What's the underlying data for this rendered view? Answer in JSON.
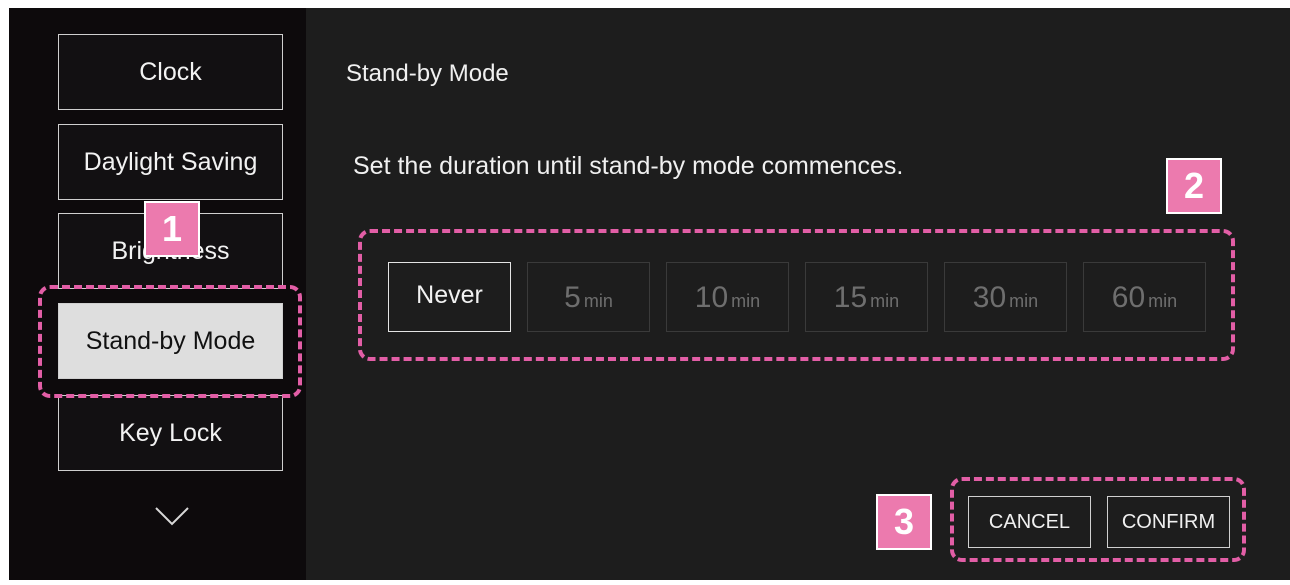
{
  "sidebar": {
    "items": [
      {
        "label": "Clock"
      },
      {
        "label": "Daylight Saving"
      },
      {
        "label": "Brightness"
      },
      {
        "label": "Stand-by Mode",
        "selected": true
      },
      {
        "label": "Key Lock"
      }
    ],
    "scroll_icon": "chevron-down-icon"
  },
  "panel": {
    "title": "Stand-by Mode",
    "description": "Set the duration until stand-by mode commences.",
    "options": [
      {
        "value": "Never",
        "unit": "",
        "selected": true
      },
      {
        "value": "5",
        "unit": "min",
        "selected": false
      },
      {
        "value": "10",
        "unit": "min",
        "selected": false
      },
      {
        "value": "15",
        "unit": "min",
        "selected": false
      },
      {
        "value": "30",
        "unit": "min",
        "selected": false
      },
      {
        "value": "60",
        "unit": "min",
        "selected": false
      }
    ],
    "cancel_label": "CANCEL",
    "confirm_label": "CONFIRM"
  },
  "callouts": {
    "one": "1",
    "two": "2",
    "three": "3"
  },
  "colors": {
    "callout_accent": "#ec7aae",
    "callout_border": "#e25ea6",
    "panel_bg": "#1d1d1d",
    "screen_bg": "#0d0a0c",
    "selected_bg": "#dedede"
  }
}
